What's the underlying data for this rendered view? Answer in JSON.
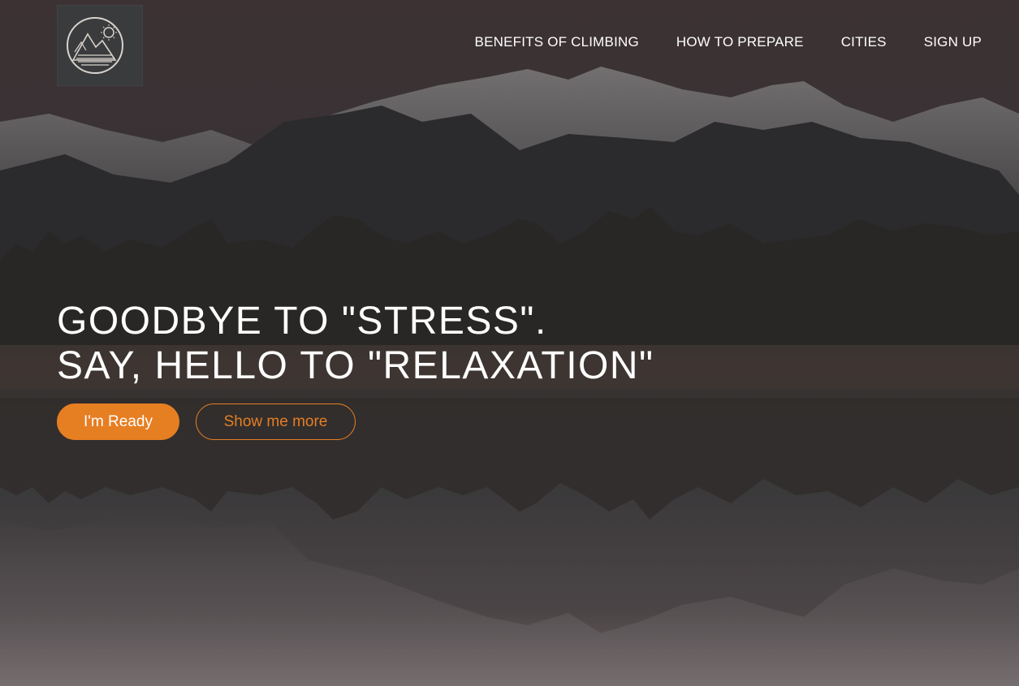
{
  "brand": {
    "logo_icon": "mountain-sun-badge-icon"
  },
  "nav": {
    "items": [
      {
        "label": "BENEFITS OF CLIMBING"
      },
      {
        "label": "HOW TO PREPARE"
      },
      {
        "label": "CITIES"
      },
      {
        "label": "SIGN UP"
      }
    ]
  },
  "hero": {
    "headline_line1": "GOODBYE TO \"STRESS\".",
    "headline_line2": "SAY, HELLO TO \"RELAXATION\"",
    "primary_button": "I'm Ready",
    "secondary_button": "Show me more"
  },
  "colors": {
    "accent": "#e67e22",
    "text": "#ffffff"
  }
}
